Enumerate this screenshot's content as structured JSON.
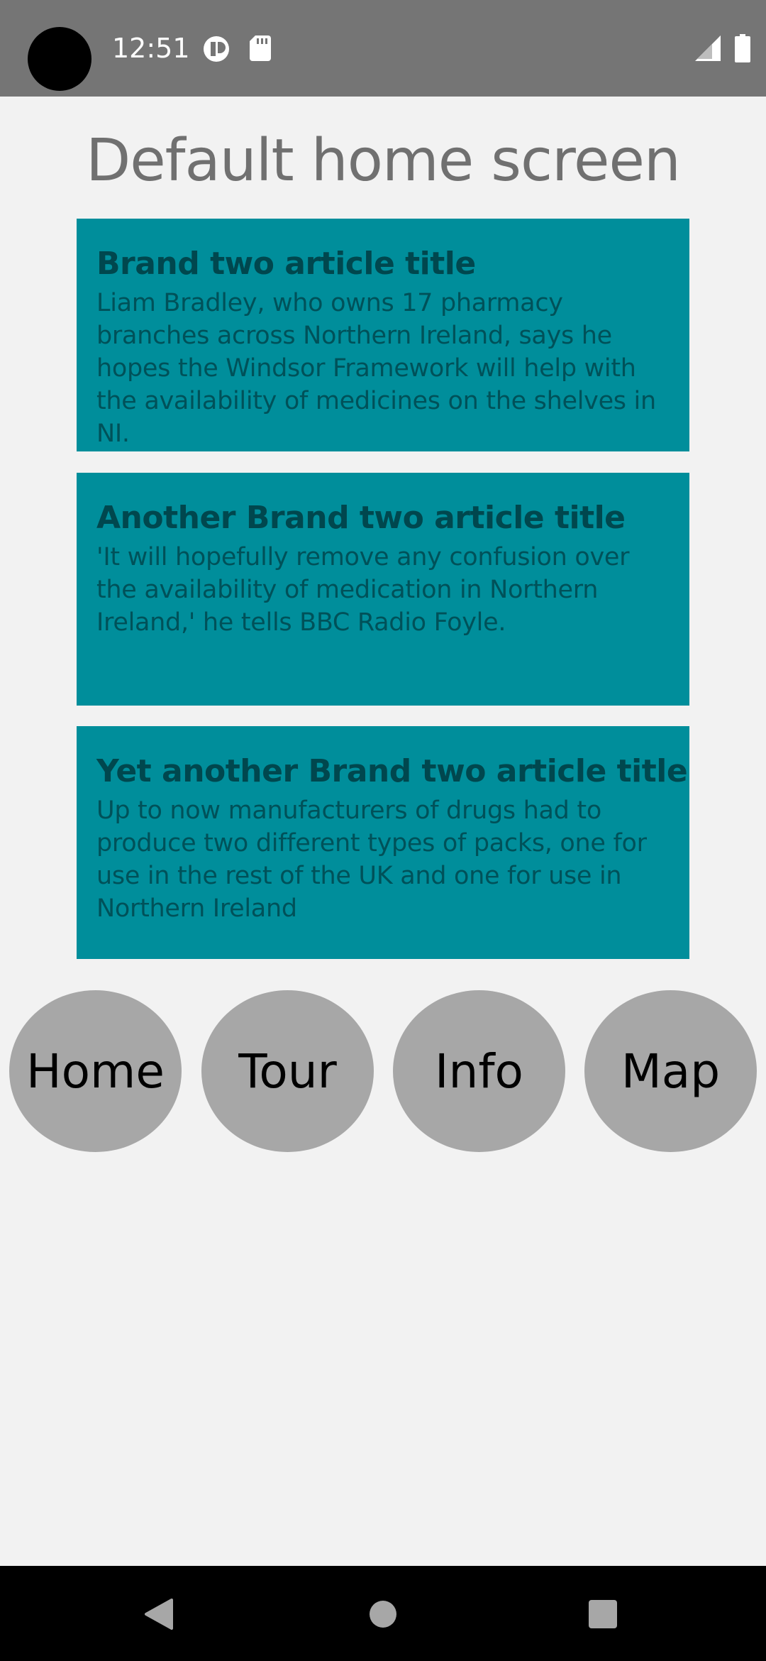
{
  "status_bar": {
    "time": "12:51",
    "icons": [
      "camera-cutout",
      "app-notification-icon",
      "sd-card-icon",
      "cell-signal-icon",
      "battery-icon"
    ]
  },
  "page": {
    "title": "Default home screen"
  },
  "articles": [
    {
      "title": "Brand two article title",
      "body": "Liam Bradley, who owns 17 pharmacy branches across Northern Ireland, says he hopes the Windsor Framework will help with the availability of medicines on the shelves in NI."
    },
    {
      "title": "Another Brand two article title",
      "body": "'It will hopefully remove any confusion over the availability of medication in Northern Ireland,' he tells BBC Radio Foyle."
    },
    {
      "title": "Yet another Brand two article title",
      "body": "Up to now manufacturers of drugs had to produce two different types of packs, one for use in the rest of the UK and one for use in Northern Ireland"
    }
  ],
  "nav": {
    "home": "Home",
    "tour": "Tour",
    "info": "Info",
    "map": "Map"
  },
  "colors": {
    "status_bar": "#757575",
    "background": "#f2f2f2",
    "card": "#008e9b",
    "card_title": "#00474e",
    "card_body": "#005159",
    "nav_button": "#a7a7a7",
    "title_text": "#707070"
  },
  "system_nav": {
    "icons": [
      "back-icon",
      "home-icon",
      "recents-icon"
    ]
  }
}
